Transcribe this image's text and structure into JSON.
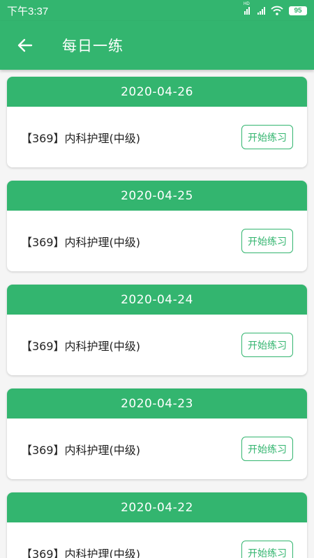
{
  "status_bar": {
    "time": "下午3:37",
    "signal_label": "HD",
    "battery": "95"
  },
  "header": {
    "title": "每日一练"
  },
  "cards": [
    {
      "date": "2020-04-26",
      "subject": "【369】内科护理(中级)",
      "button": "开始练习"
    },
    {
      "date": "2020-04-25",
      "subject": "【369】内科护理(中级)",
      "button": "开始练习"
    },
    {
      "date": "2020-04-24",
      "subject": "【369】内科护理(中级)",
      "button": "开始练习"
    },
    {
      "date": "2020-04-23",
      "subject": "【369】内科护理(中级)",
      "button": "开始练习"
    },
    {
      "date": "2020-04-22",
      "subject": "【369】内科护理(中级)",
      "button": "开始练习"
    }
  ],
  "colors": {
    "primary": "#33b56f",
    "background": "#f5f5f5"
  }
}
